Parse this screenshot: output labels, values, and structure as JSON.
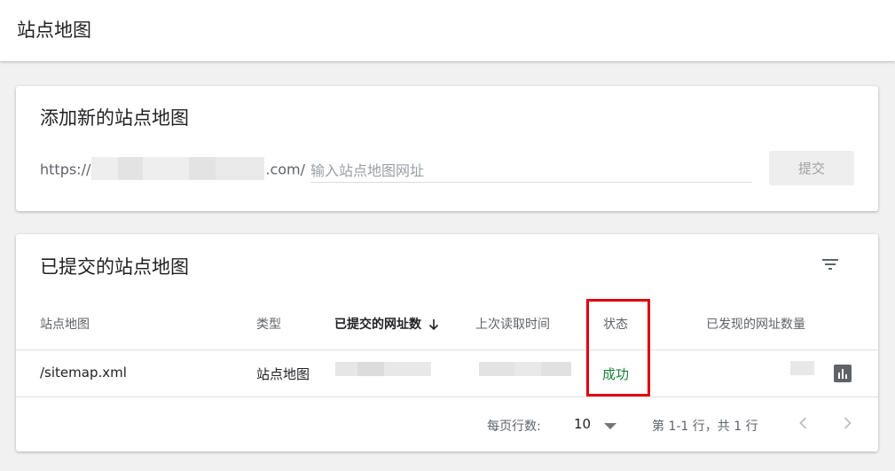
{
  "header": {
    "title": "站点地图"
  },
  "add_card": {
    "title": "添加新的站点地图",
    "url_prefix_start": "https://",
    "url_prefix_end": ".com/",
    "input_placeholder": "输入站点地图网址",
    "input_value": "",
    "submit_label": "提交"
  },
  "submitted_card": {
    "title": "已提交的站点地图",
    "columns": {
      "sitemap": "站点地图",
      "type": "类型",
      "submitted_urls": "已提交的网址数",
      "last_read": "上次读取时间",
      "status": "状态",
      "discovered_urls": "已发现的网址数量"
    },
    "rows": [
      {
        "sitemap": "/sitemap.xml",
        "type": "站点地图",
        "status": "成功"
      }
    ],
    "footer": {
      "rows_per_page_label": "每页行数:",
      "rows_per_page_value": "10",
      "range_text": "第 1-1 行，共 1 行"
    }
  },
  "colors": {
    "status_success": "#188038",
    "highlight_border": "#e0000f",
    "icon_gray": "#5f6368"
  },
  "icons": [
    "filter-icon",
    "sort-down-arrow-icon",
    "chart-icon",
    "dropdown-caret-icon",
    "chevron-left-icon",
    "chevron-right-icon"
  ]
}
